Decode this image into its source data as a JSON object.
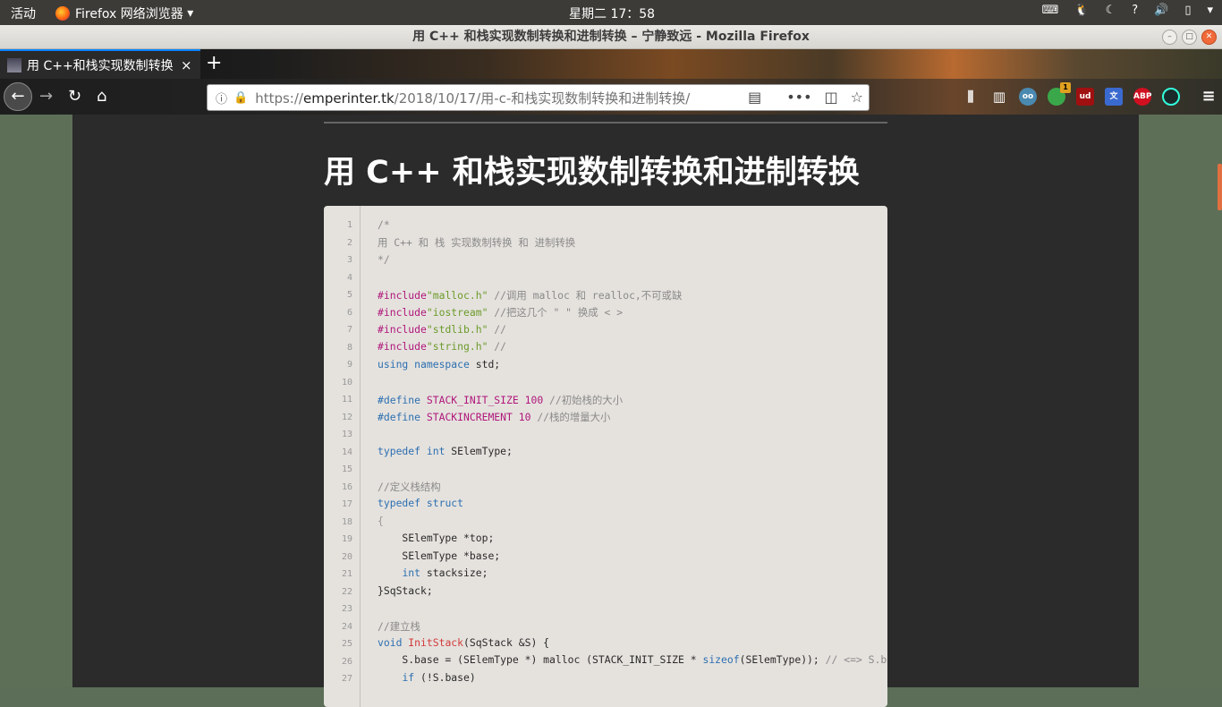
{
  "topbar": {
    "activities": "活动",
    "app_menu": "Firefox 网络浏览器",
    "clock": "星期二 17：58"
  },
  "window": {
    "title": "用 C++ 和栈实现数制转换和进制转换 – 宁静致远 - Mozilla Firefox"
  },
  "tab": {
    "label": "用 C++和栈实现数制转换",
    "close": "×"
  },
  "newtab": "+",
  "url": {
    "scheme": "https://",
    "host": "emperinter.tk",
    "path": "/2018/10/17/用-c-和栈实现数制转换和进制转换/"
  },
  "extension_badge": "1",
  "extension_abp": "ABP",
  "extension_ud": "ud",
  "article": {
    "title": "用 C++ 和栈实现数制转换和进制转换"
  },
  "code": {
    "line_numbers": [
      "1",
      "2",
      "3",
      "4",
      "5",
      "6",
      "7",
      "8",
      "9",
      "10",
      "11",
      "12",
      "13",
      "14",
      "15",
      "16",
      "17",
      "18",
      "19",
      "20",
      "21",
      "22",
      "23",
      "24",
      "25",
      "26",
      "27"
    ],
    "comment_open": "/*",
    "comment_body": "用 C++ 和 栈 实现数制转换 和 进制转换",
    "comment_close": "*/",
    "include_kw": "#include",
    "inc1_file": "\"malloc.h\"",
    "inc1_comment": " //调用 malloc 和 realloc,不可或缺",
    "inc2_file": "\"iostream\"",
    "inc2_comment": " //把这几个 \" \" 换成 < >",
    "inc3_file": "\"stdlib.h\"",
    "inc3_comment": " //",
    "inc4_file": "\"string.h\"",
    "inc4_comment": " //",
    "using_kw": "using namespace",
    "using_rest": " std;",
    "define_kw": "#define",
    "def1": " STACK_INIT_SIZE 100",
    "def1_comment": " //初始栈的大小",
    "def2": " STACKINCREMENT 10",
    "def2_comment": " //栈的增量大小",
    "typedef_kw": "typedef",
    "int_kw": "int",
    "typedef_rest": " SElemType;",
    "struct_comment": "//定义栈结构",
    "struct_kw": "struct",
    "brace_open": "{",
    "field1": "    SElemType *top;",
    "field2": "    SElemType *base;",
    "field3_rest": " stacksize;",
    "struct_close": "}SqStack;",
    "init_comment": "//建立栈",
    "void_kw": "void",
    "init_fn": "InitStack",
    "init_args": "(SqStack &S) {",
    "malloc_line_a": "    S.base = (SElemType *) malloc (STACK_INIT_SIZE * ",
    "sizeof_kw": "sizeof",
    "malloc_line_b": "(SElemType)); ",
    "malloc_comment": "// <=> S.base = (SElem",
    "if_kw": "if",
    "if_rest": " (!S.base)"
  }
}
